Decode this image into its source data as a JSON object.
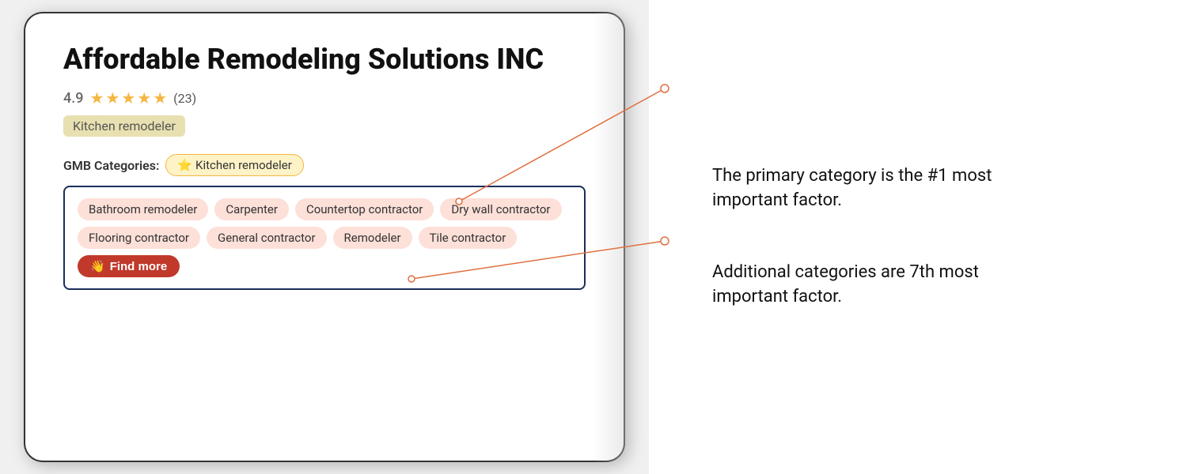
{
  "business": {
    "name": "Affordable Remodeling Solutions INC",
    "rating": "4.9",
    "review_count": "(23)",
    "primary_category": "Kitchen remodeler",
    "stars": 5
  },
  "gmb": {
    "label": "GMB Categories:",
    "primary_tag_icon": "⭐",
    "primary_tag_label": "Kitchen remodeler"
  },
  "additional_categories": [
    "Bathroom remodeler",
    "Carpenter",
    "Countertop contractor",
    "Dry wall contractor",
    "Flooring contractor",
    "General contractor",
    "Remodeler",
    "Tile contractor"
  ],
  "find_more_btn": {
    "icon": "👋",
    "label": "Find more"
  },
  "annotations": [
    {
      "id": "annotation-primary",
      "text": "The primary category is the #1 most important factor."
    },
    {
      "id": "annotation-additional",
      "text": "Additional categories are 7th most important factor."
    }
  ]
}
